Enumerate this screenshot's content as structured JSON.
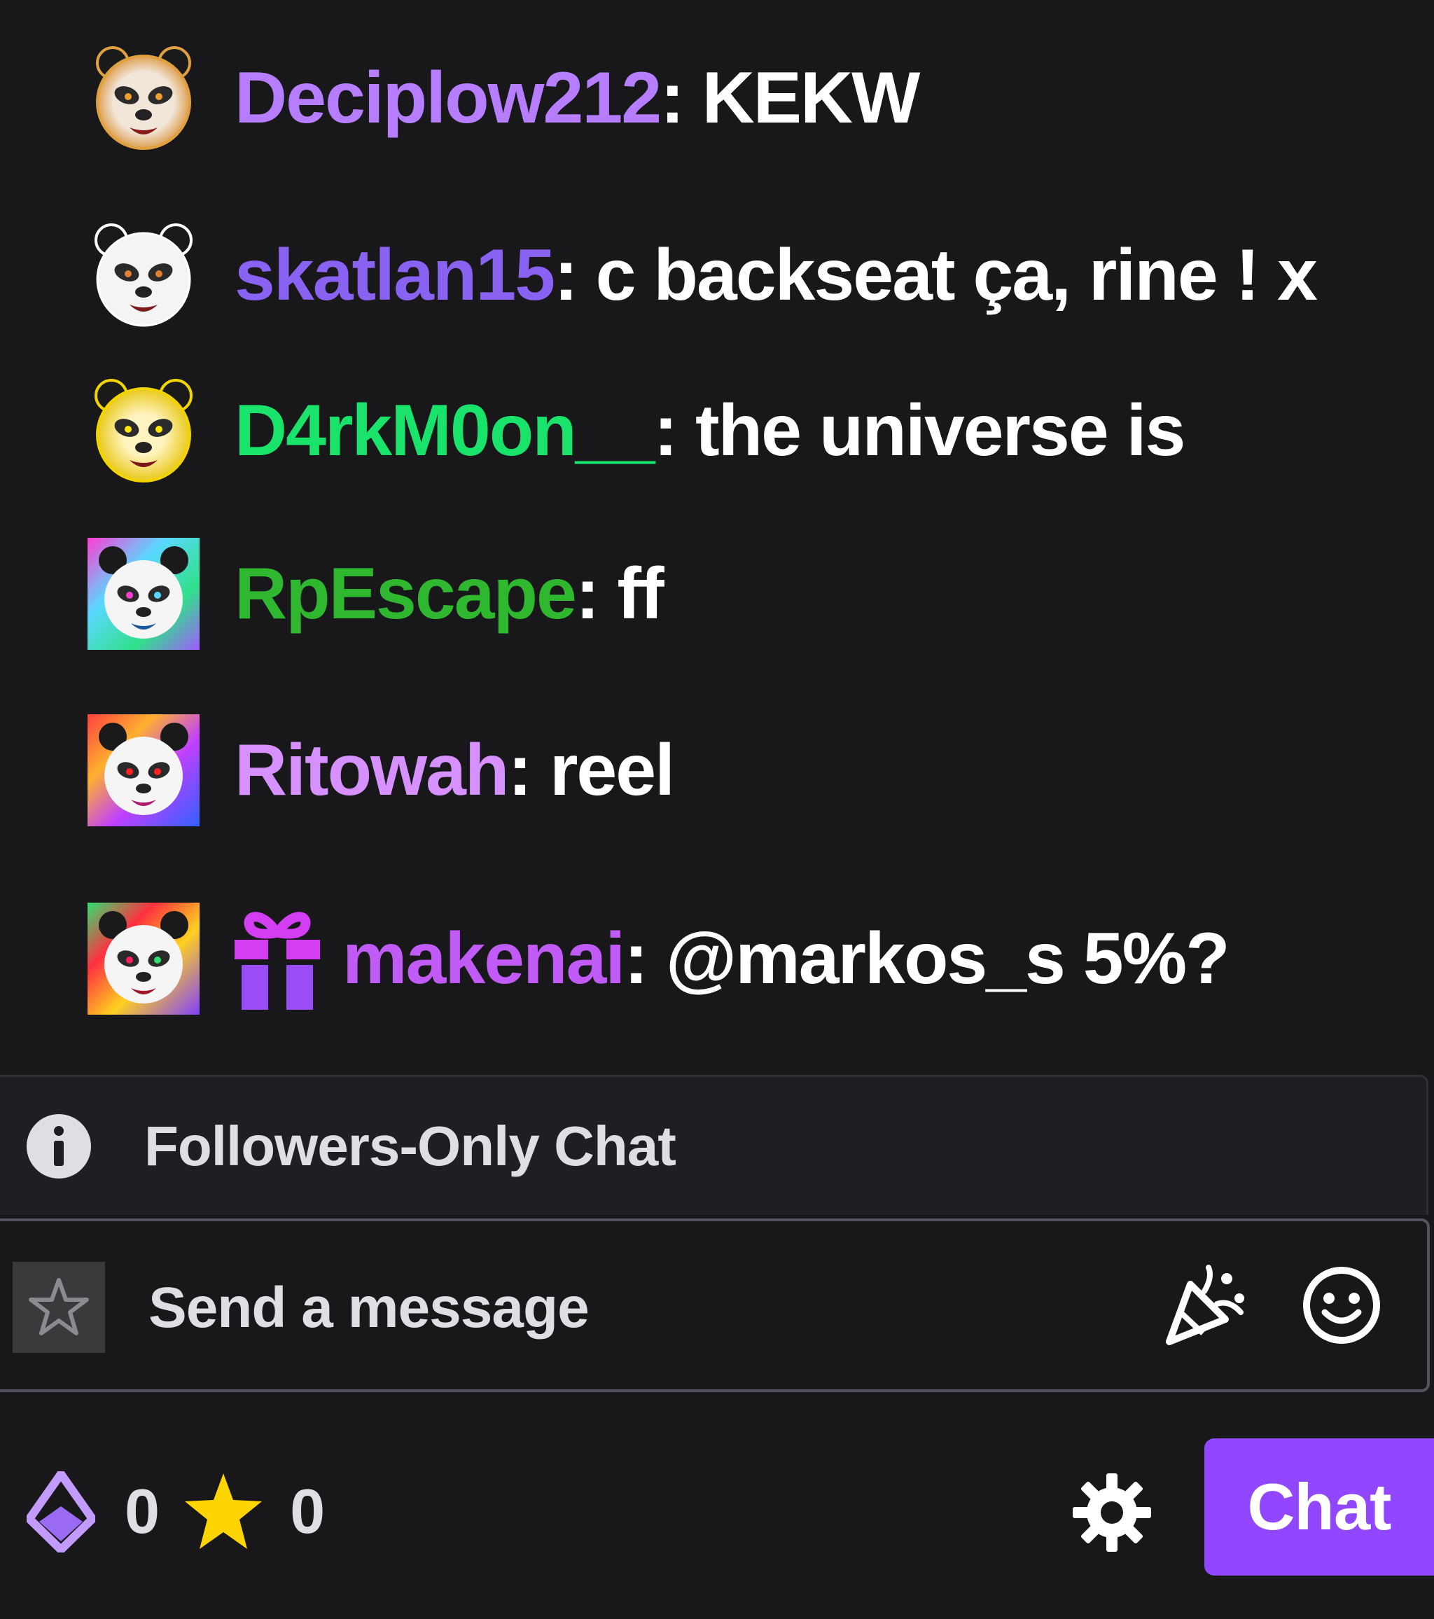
{
  "messages": [
    {
      "username": "Deciplow212",
      "separator": ": ",
      "text": "KEKW",
      "color": "#b77dff",
      "avatar": "panda-avatar-orange",
      "has_badge": false
    },
    {
      "username": "skatlan15",
      "separator": ": ",
      "text": "c backseat ça, rine ! x",
      "color": "#8a62f2",
      "avatar": "panda-avatar-white",
      "has_badge": false
    },
    {
      "username": "D4rkM0on__",
      "separator": ": ",
      "text": "the universe is",
      "color": "#19e36a",
      "avatar": "panda-avatar-gold",
      "has_badge": false
    },
    {
      "username": "RpEscape",
      "separator": ": ",
      "text": "ff",
      "color": "#2fb72f",
      "avatar": "panda-avatar-rainbow",
      "has_badge": false
    },
    {
      "username": "Ritowah",
      "separator": ": ",
      "text": "reel",
      "color": "#d691ff",
      "avatar": "panda-avatar-rainbow",
      "has_badge": false
    },
    {
      "username": "makenai",
      "separator": ": ",
      "text": "@markos_s 5%?",
      "color": "#c05cf5",
      "avatar": "panda-avatar-rainbow",
      "has_badge": true,
      "badge": "gift-icon"
    }
  ],
  "notice": {
    "text": "Followers-Only Chat",
    "icon": "info-icon"
  },
  "input": {
    "placeholder": "Send a message",
    "left_icon": "star-icon",
    "right_icons": [
      "party-popper-icon",
      "emote-smiley-icon"
    ]
  },
  "bottom_bar": {
    "bits_count": "0",
    "points_count": "0",
    "bits_icon": "bits-diamond-icon",
    "points_icon": "star-points-icon",
    "settings_icon": "gear-icon",
    "chat_button_label": "Chat",
    "accent_color": "#9147ff"
  }
}
